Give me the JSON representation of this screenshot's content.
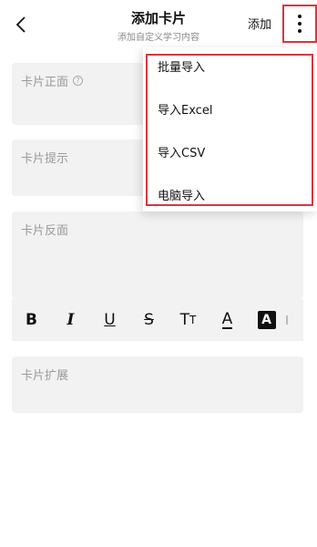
{
  "header": {
    "title": "添加卡片",
    "subtitle": "添加自定义学习内容",
    "add_label": "添加"
  },
  "fields": {
    "front_label": "卡片正面",
    "help_symbol": "?",
    "hint_label": "卡片提示",
    "back_label": "卡片反面",
    "extension_label": "卡片扩展"
  },
  "toolbar": {
    "bold": "B",
    "italic": "I",
    "underline": "U",
    "strikethrough": "S",
    "size_big": "T",
    "size_small": "T",
    "font_color": "A",
    "bg_color": "A"
  },
  "menu": {
    "items": [
      "批量导入",
      "导入Excel",
      "导入CSV",
      "电脑导入"
    ]
  },
  "colors": {
    "highlight": "#d9363e",
    "field_background": "#f2f2f2"
  }
}
